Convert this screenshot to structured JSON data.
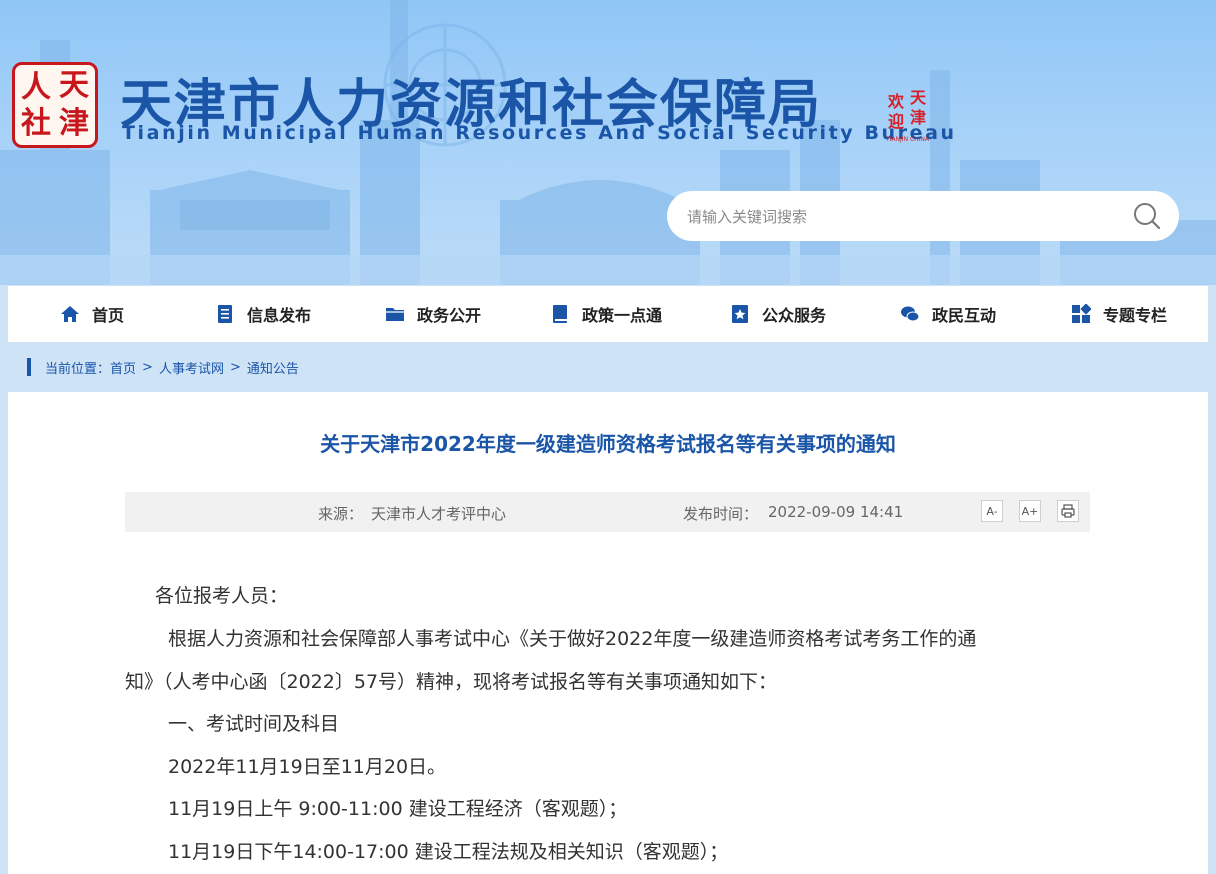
{
  "header": {
    "seal_chars": [
      "人",
      "天",
      "社",
      "津"
    ],
    "title": "天津市人力资源和社会保障局",
    "subtitle": "Tianjin Municipal Human Resources And Social Security Bureau",
    "tj_logo_chars": [
      "天",
      "津",
      "欢",
      "迎"
    ],
    "tj_logo_caption": "TIANJIN CHINA"
  },
  "search": {
    "placeholder": "请输入关键词搜索",
    "icon": "search-icon"
  },
  "nav": {
    "items": [
      {
        "label": "首页",
        "icon": "home-icon"
      },
      {
        "label": "信息发布",
        "icon": "document-icon"
      },
      {
        "label": "政务公开",
        "icon": "folder-icon"
      },
      {
        "label": "政策一点通",
        "icon": "book-icon"
      },
      {
        "label": "公众服务",
        "icon": "star-badge-icon"
      },
      {
        "label": "政民互动",
        "icon": "chat-icon"
      },
      {
        "label": "专题专栏",
        "icon": "grid-icon"
      }
    ]
  },
  "breadcrumb": {
    "prefix": "当前位置：",
    "items": [
      "首页",
      "人事考试网",
      "通知公告"
    ],
    "separator": ">"
  },
  "article": {
    "title": "关于天津市2022年度一级建造师资格考试报名等有关事项的通知",
    "source_label": "来源：",
    "source": "天津市人才考评中心",
    "date_label": "发布时间：",
    "date": "2022-09-09 14:41",
    "tools": {
      "font_smaller": "A-",
      "font_larger": "A+",
      "print": "print-icon"
    },
    "paragraphs": [
      "各位报考人员：",
      "根据人力资源和社会保障部人事考试中心《关于做好2022年度一级建造师资格考试考务工作的通",
      "知》（人考中心函〔2022〕57号）精神，现将考试报名等有关事项通知如下：",
      "一、考试时间及科目",
      "2022年11月19日至11月20日。",
      "11月19日上午 9:00-11:00 建设工程经济（客观题）；",
      "11月19日下午14:00-17:00 建设工程法规及相关知识（客观题）；"
    ]
  },
  "colors": {
    "brand_blue": "#1a55a8",
    "seal_red": "#c8161d",
    "header_sky": "#8fc6f6"
  }
}
